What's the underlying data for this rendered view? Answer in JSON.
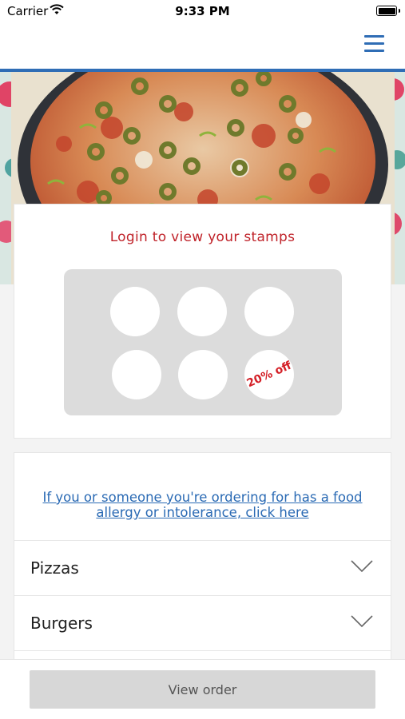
{
  "status_bar": {
    "carrier": "Carrier",
    "time": "9:33 PM",
    "wifi_icon": "wifi-icon",
    "battery_icon": "battery-icon"
  },
  "header": {
    "menu_icon": "hamburger-menu-icon",
    "accent_color": "#2f6db5"
  },
  "hero": {
    "image": "pizza-photo"
  },
  "stamps": {
    "title": "Login to view your stamps",
    "title_color": "#c0232a",
    "reward_label": "20% off",
    "reward_color": "#d41f26"
  },
  "allergy": {
    "link_text": "If you or someone you're ordering for has a food allergy or intolerance, click here"
  },
  "menu": {
    "categories": [
      {
        "label": "Pizzas"
      },
      {
        "label": "Burgers"
      }
    ]
  },
  "footer": {
    "view_order_label": "View order"
  }
}
